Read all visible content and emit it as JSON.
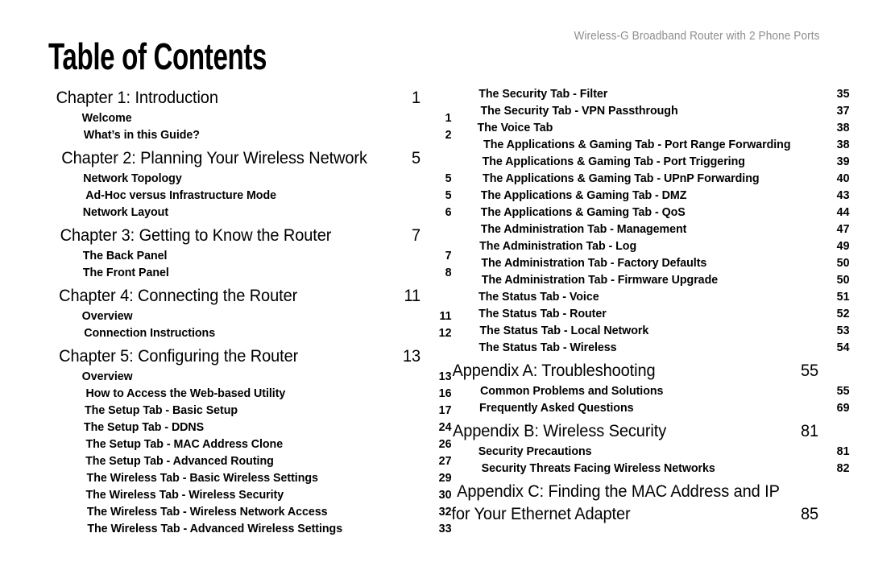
{
  "header": {
    "running_head": "Wireless-G Broadband Router with 2 Phone Ports"
  },
  "title": "Table of Contents",
  "columns": {
    "left": [
      {
        "level": "chapter",
        "label": "Chapter 1: Introduction",
        "page": "1"
      },
      {
        "level": "sub",
        "label": "Welcome",
        "page": "1"
      },
      {
        "level": "sub",
        "label": "What’s in this Guide?",
        "page": "2"
      },
      {
        "level": "chapter",
        "label": "Chapter 2: Planning Your Wireless Network",
        "page": "5"
      },
      {
        "level": "sub",
        "label": "Network Topology",
        "page": "5"
      },
      {
        "level": "sub",
        "label": "Ad-Hoc versus Infrastructure Mode",
        "page": "5"
      },
      {
        "level": "sub",
        "label": "Network Layout",
        "page": "6"
      },
      {
        "level": "chapter",
        "label": "Chapter 3: Getting to Know the Router",
        "page": "7"
      },
      {
        "level": "sub",
        "label": "The Back Panel",
        "page": "7"
      },
      {
        "level": "sub",
        "label": "The Front Panel",
        "page": "8"
      },
      {
        "level": "chapter",
        "label": "Chapter 4: Connecting the Router",
        "page": "11"
      },
      {
        "level": "sub",
        "label": "Overview",
        "page": "11"
      },
      {
        "level": "sub",
        "label": "Connection Instructions",
        "page": "12"
      },
      {
        "level": "chapter",
        "label": "Chapter 5: Configuring the Router",
        "page": "13"
      },
      {
        "level": "sub",
        "label": "Overview",
        "page": "13"
      },
      {
        "level": "sub",
        "label": "How to Access the Web-based Utility",
        "page": "16"
      },
      {
        "level": "sub",
        "label": "The Setup Tab - Basic Setup",
        "page": "17"
      },
      {
        "level": "sub",
        "label": "The Setup Tab - DDNS",
        "page": "24"
      },
      {
        "level": "sub",
        "label": "The Setup Tab - MAC Address Clone",
        "page": "26"
      },
      {
        "level": "sub",
        "label": "The Setup Tab - Advanced Routing",
        "page": "27"
      },
      {
        "level": "sub",
        "label": "The Wireless Tab - Basic Wireless Settings",
        "page": "29"
      },
      {
        "level": "sub",
        "label": "The Wireless Tab - Wireless Security",
        "page": "30"
      },
      {
        "level": "sub",
        "label": "The Wireless Tab - Wireless Network Access",
        "page": "32"
      },
      {
        "level": "sub",
        "label": "The Wireless Tab - Advanced Wireless Settings",
        "page": "33"
      }
    ],
    "right": [
      {
        "level": "sub",
        "label": "The Security Tab - Filter",
        "page": "35"
      },
      {
        "level": "sub",
        "label": "The Security Tab - VPN Passthrough",
        "page": "37"
      },
      {
        "level": "sub",
        "label": "The Voice Tab",
        "page": "38"
      },
      {
        "level": "sub",
        "label": "The Applications & Gaming Tab - Port Range Forwarding",
        "page": "38"
      },
      {
        "level": "sub",
        "label": "The Applications & Gaming Tab - Port Triggering",
        "page": "39"
      },
      {
        "level": "sub",
        "label": "The Applications & Gaming Tab - UPnP Forwarding",
        "page": "40"
      },
      {
        "level": "sub",
        "label": "The Applications & Gaming Tab - DMZ",
        "page": "43"
      },
      {
        "level": "sub",
        "label": "The Applications & Gaming Tab - QoS",
        "page": "44"
      },
      {
        "level": "sub",
        "label": "The Administration Tab - Management",
        "page": "47"
      },
      {
        "level": "sub",
        "label": "The Administration Tab - Log",
        "page": "49"
      },
      {
        "level": "sub",
        "label": "The Administration Tab - Factory Defaults",
        "page": "50"
      },
      {
        "level": "sub",
        "label": "The Administration Tab - Firmware Upgrade",
        "page": "50"
      },
      {
        "level": "sub",
        "label": "The Status Tab - Voice",
        "page": "51"
      },
      {
        "level": "sub",
        "label": "The Status Tab - Router",
        "page": "52"
      },
      {
        "level": "sub",
        "label": "The Status Tab - Local Network",
        "page": "53"
      },
      {
        "level": "sub",
        "label": "The Status Tab - Wireless",
        "page": "54"
      },
      {
        "level": "chapter",
        "label": "Appendix A: Troubleshooting",
        "page": "55"
      },
      {
        "level": "sub",
        "label": "Common Problems and Solutions",
        "page": "55"
      },
      {
        "level": "sub",
        "label": "Frequently Asked Questions",
        "page": "69"
      },
      {
        "level": "chapter",
        "label": "Appendix B: Wireless Security",
        "page": "81"
      },
      {
        "level": "sub",
        "label": "Security Precautions",
        "page": "81"
      },
      {
        "level": "sub",
        "label": "Security Threats Facing Wireless Networks",
        "page": "82"
      },
      {
        "level": "chapter",
        "label": "Appendix C: Finding the MAC Address and IP Address",
        "page": ""
      },
      {
        "level": "chapter",
        "continuation": true,
        "label": "for Your Ethernet Adapter",
        "page": "85"
      }
    ]
  }
}
